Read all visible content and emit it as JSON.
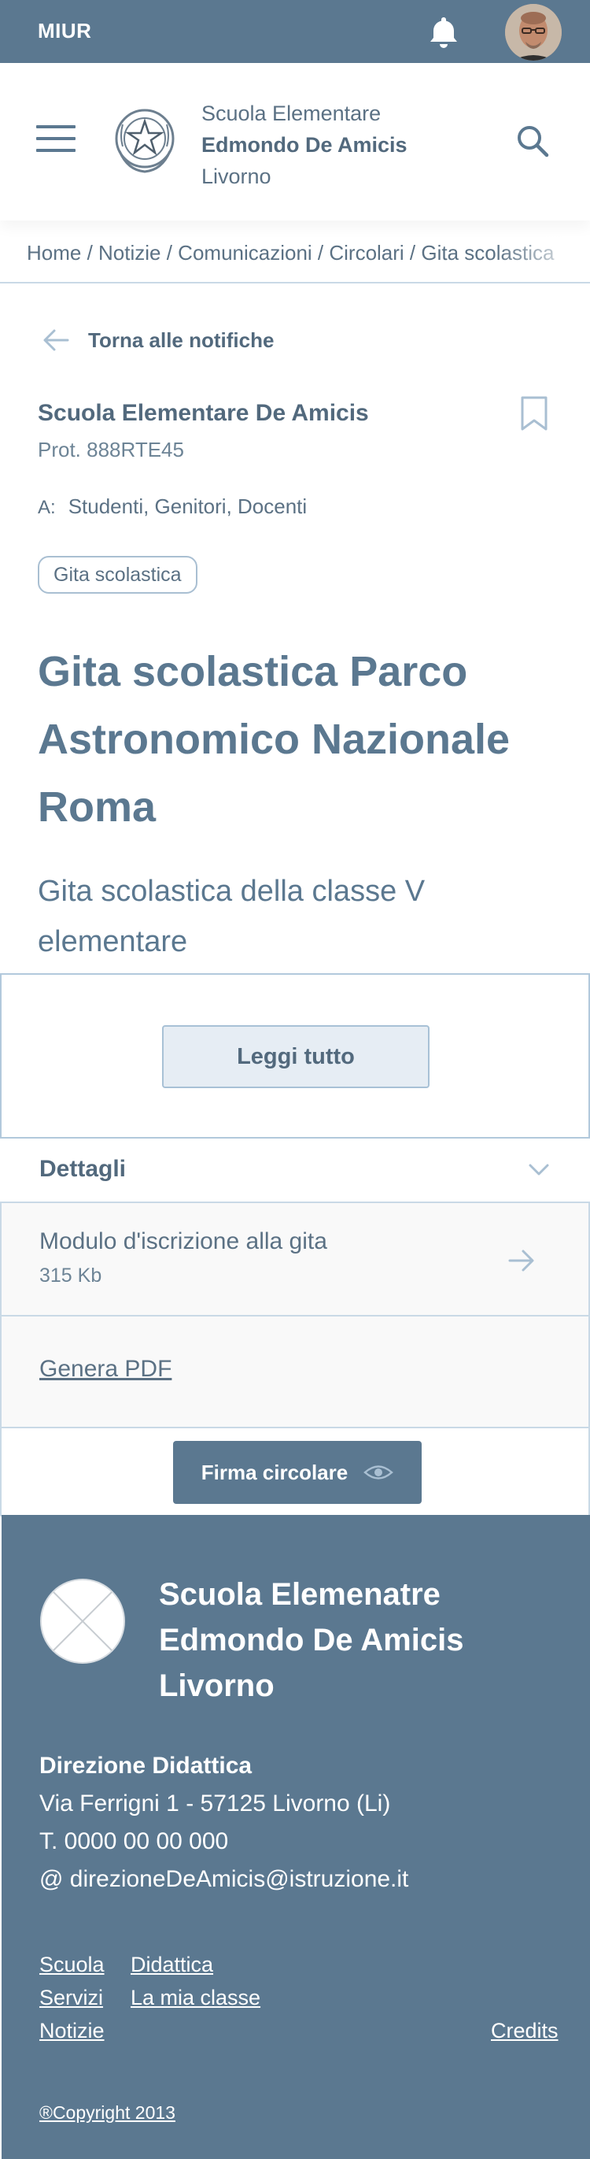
{
  "topbar": {
    "brand": "MIUR",
    "bell_icon": "bell-icon"
  },
  "header": {
    "line1": "Scuola Elementare",
    "line2": "Edmondo De Amicis",
    "line3": "Livorno"
  },
  "breadcrumb": "Home / Notizie / Comunicazioni / Circolari / Gita scolastica",
  "back_label": "Torna alle notifiche",
  "notice": {
    "sender": "Scuola Elementare De Amicis",
    "prot": "Prot. 888RTE45",
    "recipients_label": "A:",
    "recipients": "Studenti, Genitori, Docenti",
    "tag": "Gita scolastica",
    "title": "Gita scolastica Parco Astronomico Nazionale Roma",
    "subtitle": "Gita scolastica della classe V elementare"
  },
  "read_more_label": "Leggi tutto",
  "details": {
    "label": "Dettagli",
    "file_name": "Modulo d'iscrizione alla gita",
    "file_size": "315 Kb",
    "pdf_label": "Genera PDF"
  },
  "sign_label": "Firma circolare",
  "footer": {
    "line1": "Scuola Elemenatre",
    "line2": "Edmondo De Amicis",
    "line3": "Livorno",
    "direction_title": "Direzione Didattica",
    "address": "Via Ferrigni 1 - 57125 Livorno (Li)",
    "phone": "T. 0000 00 00 000",
    "email": "@ direzioneDeAmicis@istruzione.it",
    "links": {
      "scuola": "Scuola",
      "didattica": "Didattica",
      "servizi": "Servizi",
      "mia_classe": "La mia classe",
      "notizie": "Notizie",
      "credits": "Credits"
    },
    "copyright": "®Copyright 2013"
  },
  "colors": {
    "primary": "#5b7890",
    "text": "#5b7184",
    "border": "#c9d9e6",
    "button_bg": "#e6edf4"
  }
}
